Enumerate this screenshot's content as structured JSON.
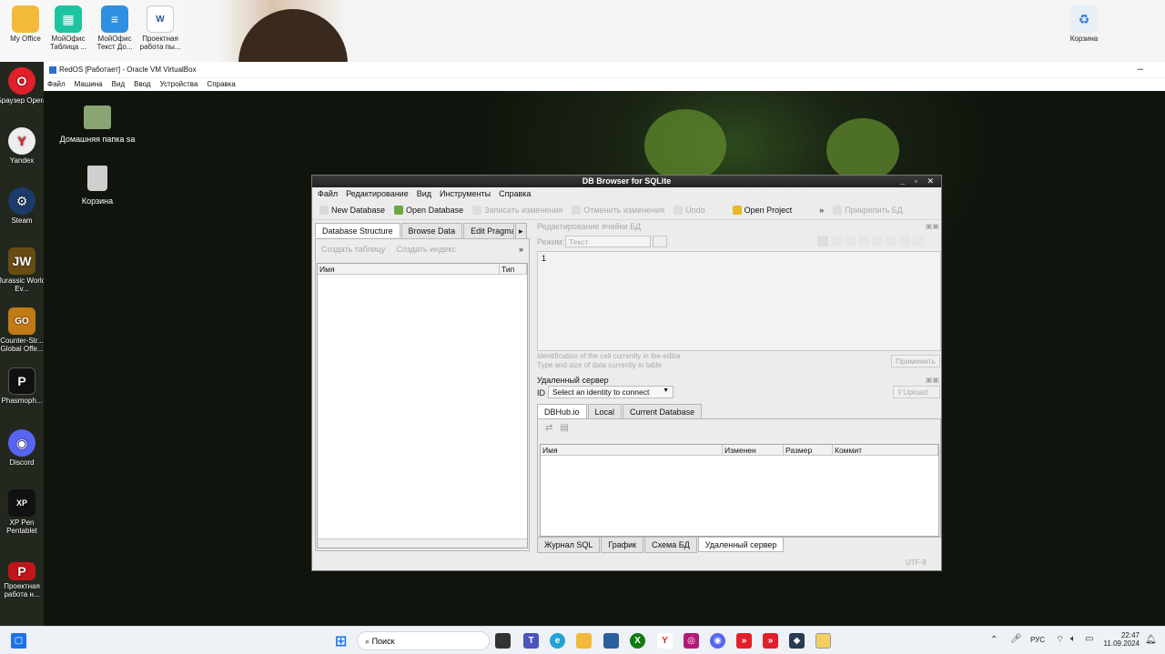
{
  "host": {
    "top_icons": [
      {
        "label": "My Office",
        "icon": "folder-icon",
        "color": "#f2b93b"
      },
      {
        "label": "МойОфис Таблица ...",
        "icon": "spreadsheet-icon",
        "color": "#1ec4a0"
      },
      {
        "label": "МойОфис Текст До...",
        "icon": "text-doc-icon",
        "color": "#2f8fe0"
      },
      {
        "label": "Проектная работа пы...",
        "icon": "word-doc-icon",
        "color": "#ffffff"
      },
      {
        "label": "Корзина",
        "icon": "recycle-bin-icon",
        "color": "#ffffff"
      }
    ],
    "left_icons": [
      {
        "label": "Браузер Opera",
        "icon": "opera-icon",
        "color": "#e0202a"
      },
      {
        "label": "Yandex",
        "icon": "yandex-icon",
        "color": "#e8e8e8"
      },
      {
        "label": "Steam",
        "icon": "steam-icon",
        "color": "#1b3b6a"
      },
      {
        "label": "Jurassic World Ev...",
        "icon": "jurassic-icon",
        "color": "#6a4b12"
      },
      {
        "label": "Counter-Str... Global Offe...",
        "icon": "csgo-icon",
        "color": "#c27a16"
      },
      {
        "label": "Phasmoph...",
        "icon": "phasmophobia-icon",
        "color": "#111111"
      },
      {
        "label": "Discord",
        "icon": "discord-icon",
        "color": "#5865f2"
      },
      {
        "label": "XP Pen Pentablet",
        "icon": "xppen-icon",
        "color": "#111111"
      },
      {
        "label": "Проектная работа н...",
        "icon": "pdf-doc-icon",
        "color": "#c0161b"
      }
    ]
  },
  "vm": {
    "title": "RedOS [Работает] - Oracle VM VirtualBox",
    "minimize": "–",
    "menu": [
      "Файл",
      "Машина",
      "Вид",
      "Ввод",
      "Устройства",
      "Справка"
    ],
    "desktop_icons": [
      {
        "label": "Домашняя папка sa",
        "icon": "home-folder-icon"
      },
      {
        "label": "Корзина",
        "icon": "trash-icon"
      }
    ]
  },
  "app": {
    "title": "DB Browser for SQLite",
    "win_buttons": "_ ▫ ✕",
    "menu": [
      "Файл",
      "Редактирование",
      "Вид",
      "Инструменты",
      "Справка"
    ],
    "toolbar": {
      "new_db": "New Database",
      "open_db": "Open Database",
      "write": "Записать изменения",
      "revert": "Отменить изменения",
      "undo": "Undo",
      "open_project": "Open Project",
      "more": "»",
      "attach": "Прикрепить БД"
    },
    "left_tabs": [
      "Database Structure",
      "Browse Data",
      "Edit Pragma"
    ],
    "left_toolbar": {
      "create_table": "Создать таблицу",
      "create_index": "Создать индекс",
      "more": "»"
    },
    "left_columns": [
      "Имя",
      "Тип"
    ],
    "edit_cell": {
      "title": "Редактирование ячейки БД",
      "mode_label": "Режим:",
      "mode_value": "Текст",
      "content": "1",
      "info1": "Identification of the cell currently in the editor",
      "info2": "Type and size of data currently in table",
      "apply": "Применить"
    },
    "remote": {
      "title": "Удаленный сервер",
      "id_label": "ID",
      "identity": "Select an identity to connect",
      "upload": "Upload",
      "tabs": [
        "DBHub.io",
        "Local",
        "Current Database"
      ],
      "columns": [
        "Имя",
        "Изменен",
        "Размер",
        "Коммит"
      ]
    },
    "bottom_tabs": [
      "Журнал SQL",
      "График",
      "Схема БД",
      "Удаленный сервер"
    ],
    "encoding": "UTF-8"
  },
  "taskbar": {
    "search": "Поиск",
    "lang": "РУС",
    "time": "22:47",
    "date": "11.09.2024"
  }
}
